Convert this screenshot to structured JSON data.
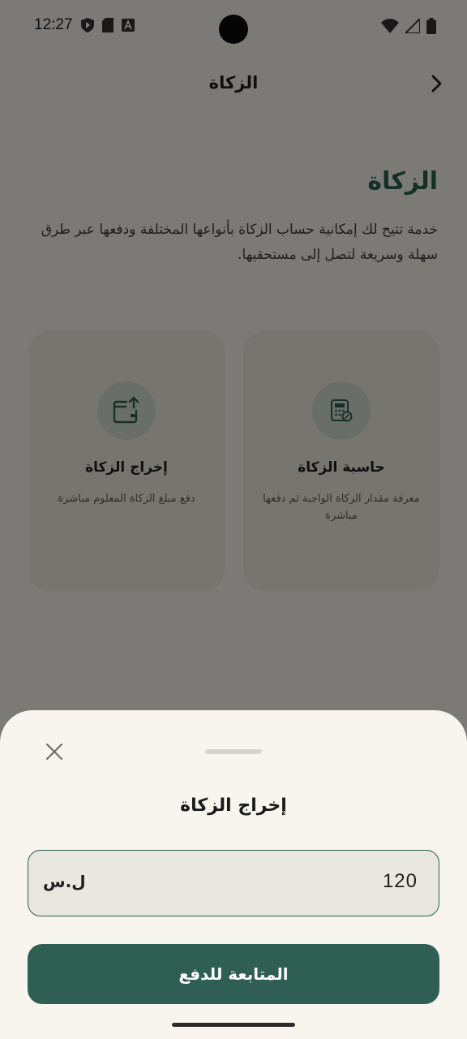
{
  "status_bar": {
    "time": "12:27",
    "left_icons": [
      "play-shield-icon",
      "sd-card-icon",
      "font-a-icon"
    ],
    "right_icons": [
      "wifi-icon",
      "signal-icon",
      "battery-icon"
    ]
  },
  "top_bar": {
    "title": "الزكاة",
    "back_icon": "chevron-right-icon"
  },
  "page": {
    "heading": "الزكاة",
    "description": "خدمة تتيح لك إمكانية حساب الزكاة بأنواعها المختلفة ودفعها عبر طرق سهلة وسريعة لتصل إلى مستحقيها."
  },
  "cards": [
    {
      "icon": "calculator-icon",
      "title": "حاسبة الزكاة",
      "description": "معرفة مقدار الزكاة الواجبة ثم دفعها مباشرة"
    },
    {
      "icon": "wallet-upload-icon",
      "title": "إخراج الزكاة",
      "description": "دفع مبلغ الزكاة المعلوم مباشرة"
    }
  ],
  "sheet": {
    "title": "إخراج الزكاة",
    "amount": "120",
    "currency": "ل.س",
    "continue_label": "المتابعة للدفع",
    "close_icon": "close-icon"
  },
  "colors": {
    "accent": "#2f5e52",
    "background": "#f7f5ee",
    "card": "#eeebdf",
    "scrim": "rgba(0,0,0,0.5)"
  }
}
